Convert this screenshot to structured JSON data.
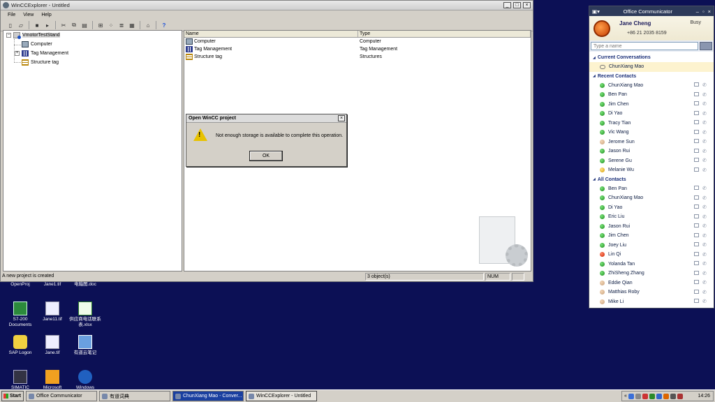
{
  "wincc": {
    "title": "WinCCExplorer - Untitled",
    "menu": [
      "File",
      "View",
      "Help"
    ],
    "tree": {
      "root": "VmotorTestStand",
      "children": [
        "Computer",
        "Tag Management",
        "Structure tag"
      ]
    },
    "list": {
      "columns": [
        "Name",
        "Type"
      ],
      "rows": [
        {
          "name": "Computer",
          "type": "Computer"
        },
        {
          "name": "Tag Management",
          "type": "Tag Management"
        },
        {
          "name": "Structure tag",
          "type": "Structures"
        }
      ]
    },
    "status": {
      "message": "A new project is created",
      "objects": "3 object(s)",
      "num": "NUM"
    }
  },
  "dialog": {
    "title": "Open WinCC project",
    "message": "Not enough storage is available to complete this operation.",
    "ok": "OK"
  },
  "communicator": {
    "title": "Office Communicator",
    "user": "Jane Cheng",
    "status": "Busy",
    "phone": "+86 21 2035 8159",
    "search_placeholder": "Type a name",
    "groups": {
      "current": "Current Conversations",
      "recent": "Recent Contacts",
      "all": "All Contacts"
    },
    "current": [
      {
        "name": "ChunXiang Mao"
      }
    ],
    "recent": [
      {
        "name": "ChunXiang Mao",
        "presence": "green"
      },
      {
        "name": "Ben Pan",
        "presence": "green"
      },
      {
        "name": "Jim Chen",
        "presence": "green"
      },
      {
        "name": "Di Yao",
        "presence": "green"
      },
      {
        "name": "Tracy Tian",
        "presence": "green"
      },
      {
        "name": "Vic Wang",
        "presence": "green"
      },
      {
        "name": "Jerome Sun",
        "presence": "grey"
      },
      {
        "name": "Jason Rui",
        "presence": "green"
      },
      {
        "name": "Serene Gu",
        "presence": "green"
      },
      {
        "name": "Melanie Wu",
        "presence": "yellow"
      }
    ],
    "all": [
      {
        "name": "Ben Pan",
        "presence": "green"
      },
      {
        "name": "ChunXiang Mao",
        "presence": "green"
      },
      {
        "name": "Di Yao",
        "presence": "green"
      },
      {
        "name": "Eric Liu",
        "presence": "green"
      },
      {
        "name": "Jason Rui",
        "presence": "green"
      },
      {
        "name": "Jim Chen",
        "presence": "green"
      },
      {
        "name": "Joey Liu",
        "presence": "green"
      },
      {
        "name": "Lin Qi",
        "presence": "red"
      },
      {
        "name": "Yolanda Tan",
        "presence": "green"
      },
      {
        "name": "ZhiSheng Zhang",
        "presence": "green"
      },
      {
        "name": "Eddie Qian",
        "presence": "grey"
      },
      {
        "name": "Matthias Roby",
        "presence": "grey"
      },
      {
        "name": "Mike Li",
        "presence": "grey"
      }
    ]
  },
  "desktop": {
    "icons": [
      {
        "label": "OpenProj"
      },
      {
        "label": "Jane1.tif"
      },
      {
        "label": "电箱图.doc"
      },
      {
        "label": "S7-200 Documents"
      },
      {
        "label": "Jane11.tif"
      },
      {
        "label": "供应商电话联系表.xlsx"
      },
      {
        "label": "SAP Logon"
      },
      {
        "label": "Jane.tif"
      },
      {
        "label": "有道云笔记"
      },
      {
        "label": "SIMATIC"
      },
      {
        "label": "Microsoft"
      },
      {
        "label": "Windows"
      }
    ]
  },
  "taskbar": {
    "start": "Start",
    "tasks": [
      "Office Communicator",
      "有道词典",
      "ChunXiang Mao - Conver...",
      "WinCCExplorer - Untitled"
    ],
    "clock": "14:26"
  }
}
